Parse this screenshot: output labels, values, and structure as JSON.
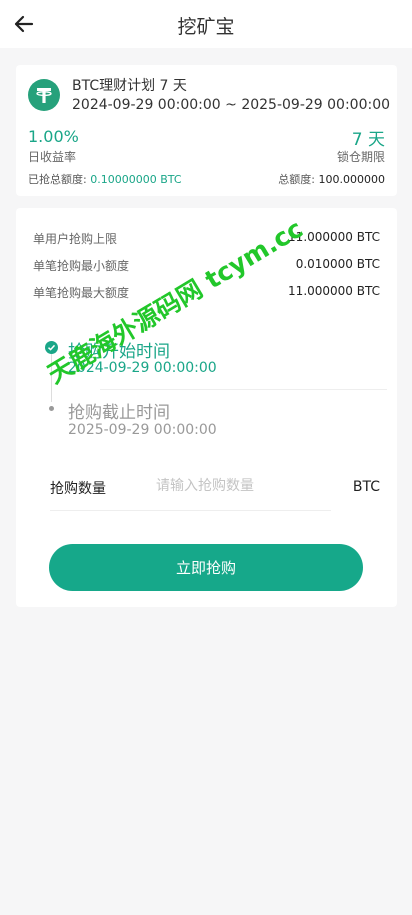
{
  "header": {
    "title": "挖矿宝",
    "back_icon": "arrow-left-icon"
  },
  "plan": {
    "coin_icon": "tether-icon",
    "name": "BTC理财计划 7 天",
    "dates": "2024-09-29 00:00:00 ~ 2025-09-29 00:00:00",
    "daily_rate_value": "1.00%",
    "daily_rate_label": "日收益率",
    "lock_value": "7 天",
    "lock_label": "锁仓期限",
    "sold_label": "已抢总额度:",
    "sold_value": "0.10000000 BTC",
    "total_label": "总额度:",
    "total_value": "100.000000"
  },
  "limits": [
    {
      "label": "单用户抢购上限",
      "value": "11.000000 BTC"
    },
    {
      "label": "单笔抢购最小额度",
      "value": "0.010000 BTC"
    },
    {
      "label": "单笔抢购最大额度",
      "value": "11.000000 BTC"
    }
  ],
  "timeline": {
    "start_title": "抢购开始时间",
    "start_date": "2024-09-29 00:00:00",
    "end_title": "抢购截止时间",
    "end_date": "2025-09-29 00:00:00"
  },
  "purchase": {
    "qty_label": "抢购数量",
    "qty_placeholder": "请输入抢购数量",
    "qty_value": "",
    "unit": "BTC",
    "button_label": "立即抢购"
  },
  "watermark": "天鹿海外源码网 tcym.cc",
  "colors": {
    "accent": "#16a88a",
    "watermark": "#22c72a"
  }
}
